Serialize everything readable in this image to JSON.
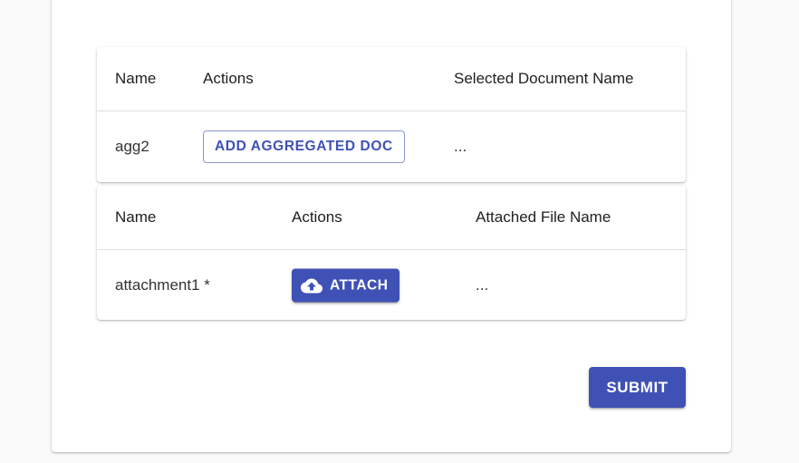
{
  "aggregated_docs_table": {
    "headers": {
      "name": "Name",
      "actions": "Actions",
      "selected_document_name": "Selected Document Name"
    },
    "rows": [
      {
        "name": "agg2",
        "action_label": "ADD AGGREGATED DOC",
        "selected_document_name": "..."
      }
    ]
  },
  "attachments_table": {
    "headers": {
      "name": "Name",
      "actions": "Actions",
      "attached_file_name": "Attached File Name"
    },
    "rows": [
      {
        "name": "attachment1 *",
        "action_label": "ATTACH",
        "action_icon": "cloud-upload-icon",
        "attached_file_name": "..."
      }
    ]
  },
  "form": {
    "submit_label": "SUBMIT"
  },
  "colors": {
    "primary": "#3f51b5",
    "background": "#fafafa",
    "card": "#ffffff"
  }
}
